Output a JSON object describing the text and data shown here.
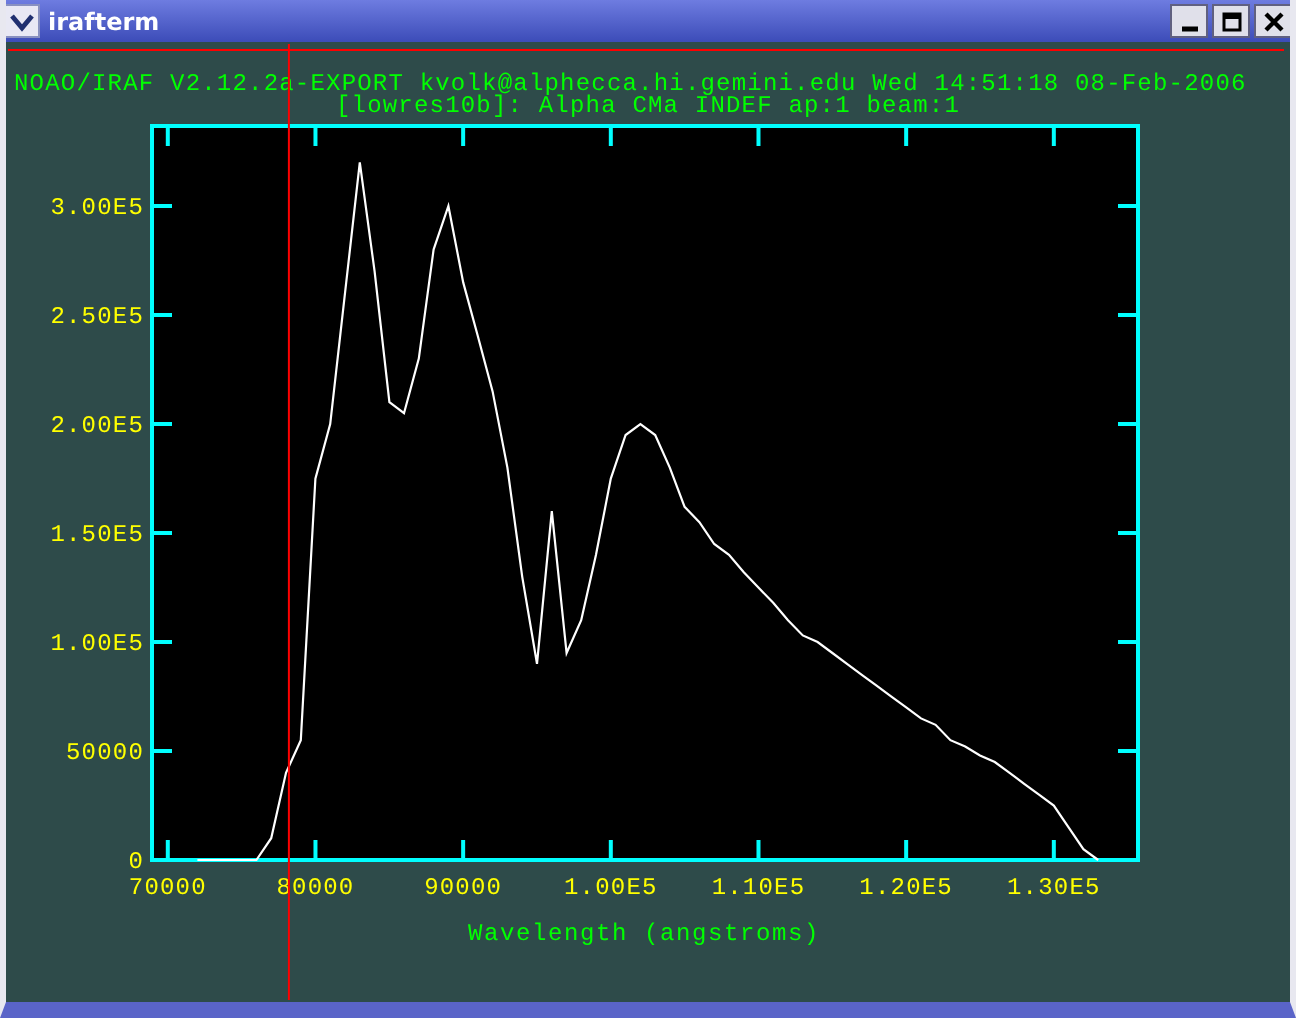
{
  "window": {
    "title": "irafterm"
  },
  "header": [
    "NOAO/IRAF V2.12.2a-EXPORT kvolk@alphecca.hi.gemini.edu Wed 14:51:18 08-Feb-2006",
    "[lowres10b]: Alpha CMa INDEF ap:1 beam:1"
  ],
  "chart_data": {
    "type": "line",
    "xlabel": "Wavelength (angstroms)",
    "xlim": [
      68930,
      135700
    ],
    "ylim": [
      0,
      336700
    ],
    "xticks": [
      {
        "value": 70000,
        "label": "70000"
      },
      {
        "value": 80000,
        "label": "80000"
      },
      {
        "value": 90000,
        "label": "90000"
      },
      {
        "value": 100000,
        "label": "1.00E5"
      },
      {
        "value": 110000,
        "label": "1.10E5"
      },
      {
        "value": 120000,
        "label": "1.20E5"
      },
      {
        "value": 130000,
        "label": "1.30E5"
      }
    ],
    "yticks": [
      {
        "value": 0,
        "label": "0"
      },
      {
        "value": 50000,
        "label": "50000"
      },
      {
        "value": 100000,
        "label": "1.00E5"
      },
      {
        "value": 150000,
        "label": "1.50E5"
      },
      {
        "value": 200000,
        "label": "2.00E5"
      },
      {
        "value": 250000,
        "label": "2.50E5"
      },
      {
        "value": 300000,
        "label": "3.00E5"
      }
    ],
    "x": [
      72000,
      76000,
      77000,
      78000,
      79000,
      80000,
      81000,
      82000,
      83000,
      84000,
      85000,
      86000,
      87000,
      88000,
      89000,
      90000,
      91000,
      92000,
      93000,
      94000,
      95000,
      96000,
      97000,
      98000,
      99000,
      100000,
      101000,
      102000,
      103000,
      104000,
      105000,
      106000,
      107000,
      108000,
      109000,
      110000,
      111000,
      112000,
      113000,
      114000,
      115000,
      116000,
      117000,
      118000,
      119000,
      120000,
      121000,
      122000,
      123000,
      124000,
      125000,
      126000,
      127000,
      128000,
      129000,
      130000,
      131000,
      132000,
      133000
    ],
    "series": [
      {
        "color": "#ffffff",
        "values": [
          0,
          0,
          10000,
          40000,
          55000,
          175000,
          200000,
          260000,
          320000,
          270000,
          210000,
          205000,
          230000,
          280000,
          300000,
          265000,
          240000,
          215000,
          180000,
          130000,
          90000,
          160000,
          95000,
          110000,
          140000,
          175000,
          195000,
          200000,
          195000,
          180000,
          162000,
          155000,
          145000,
          140000,
          132000,
          125000,
          118000,
          110000,
          103000,
          100000,
          95000,
          90000,
          85000,
          80000,
          75000,
          70000,
          65000,
          62000,
          55000,
          52000,
          48000,
          45000,
          40000,
          35000,
          30000,
          25000,
          15000,
          5000,
          0
        ]
      }
    ],
    "ref_lines": [
      {
        "axis": "x",
        "value": 78200,
        "color": "#ff0000"
      }
    ]
  }
}
